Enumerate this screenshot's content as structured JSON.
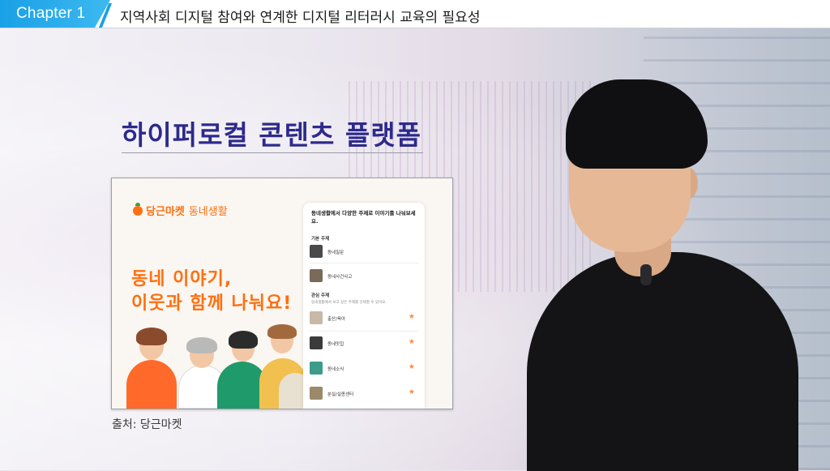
{
  "header": {
    "chapter_label": "Chapter 1",
    "title": "지역사회 디지털 참여와 연계한 디지털 리터러시 교육의 필요성"
  },
  "slide": {
    "title": "하이퍼로컬 콘텐츠 플랫폼",
    "caption": "출처: 당근마켓"
  },
  "screenshot": {
    "brand": "당근마켓",
    "brand_sub": "동네생활",
    "headline_line1": "동네 이야기,",
    "headline_line2": "이웃과 함께 나눠요!",
    "panel_heading": "동네생활에서 다양한 주제로 이야기를 나눠보세요.",
    "section_basic": "기본 주제",
    "section_interest": "관심 주제",
    "section_interest_desc": "동네생활에서 보고 싶은 주제를 선택할 수 있어요.",
    "basic_items": [
      "동네질문",
      "동네사건사고"
    ],
    "interest_items": [
      "출산/육아",
      "동네맛집",
      "동네소식",
      "분실/실종센터"
    ],
    "accent_color": "#ff6f0f"
  }
}
